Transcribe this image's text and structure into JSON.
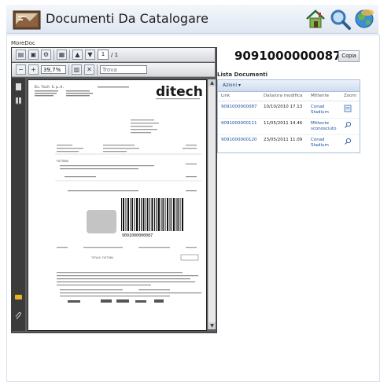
{
  "header": {
    "title": "Documenti Da Catalogare",
    "icons": [
      "home-icon",
      "search-icon",
      "globe-icon"
    ]
  },
  "panel_label": "MoreDoc",
  "viewer": {
    "page_current": "1",
    "page_total": "/ 1",
    "zoom": "39,7%",
    "find_placeholder": "Trova",
    "document_text": {
      "company": "Di.Tech S.p.A.",
      "logo": "ditech",
      "doc_type": "FATTURA",
      "barcode_number": "9091000000087",
      "footer_label": "TOTALE FATTURA"
    }
  },
  "document": {
    "number": "9091000000087",
    "copy_label": "Copia"
  },
  "list": {
    "title": "Lista Documenti",
    "actions_label": "Azioni ▾",
    "columns": [
      "Link",
      "Data/ora modifica",
      "Mittente",
      "Zoom"
    ],
    "rows": [
      {
        "link": "9091000000087",
        "date": "10/10/2010 17.13",
        "sender": "Conad Stadium",
        "zoom_icon": "document-preview-icon"
      },
      {
        "link": "9091000000111",
        "date": "11/05/2011 14.46",
        "sender": "Mittente sconosciuto",
        "zoom_icon": "magnifier-icon"
      },
      {
        "link": "9091000000120",
        "date": "23/05/2011 11.09",
        "sender": "Conad Stadium",
        "zoom_icon": "magnifier-icon"
      }
    ]
  }
}
